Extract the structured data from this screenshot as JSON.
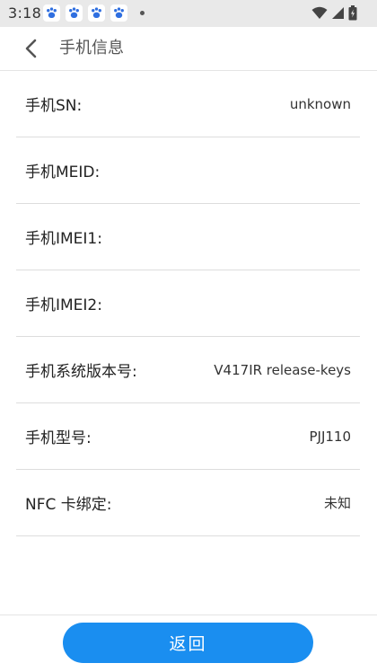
{
  "status_bar": {
    "time": "3:18",
    "notification_icons": [
      "baidu-paw-icon",
      "baidu-paw-icon",
      "baidu-paw-icon",
      "baidu-paw-icon"
    ],
    "indicators": [
      "wifi-icon",
      "signal-icon",
      "battery-icon"
    ]
  },
  "header": {
    "title": "手机信息",
    "back_icon": "chevron-left-icon"
  },
  "info": {
    "rows": [
      {
        "label": "手机SN:",
        "value": "unknown"
      },
      {
        "label": "手机MEID:",
        "value": ""
      },
      {
        "label": "手机IMEI1:",
        "value": ""
      },
      {
        "label": "手机IMEI2:",
        "value": ""
      },
      {
        "label": "手机系统版本号:",
        "value": "V417IR release-keys"
      },
      {
        "label": "手机型号:",
        "value": "PJJ110"
      },
      {
        "label": "NFC 卡绑定:",
        "value": "未知"
      }
    ]
  },
  "footer": {
    "return_label": "返回"
  },
  "colors": {
    "accent": "#1a8ef0",
    "notification_icon": "#2f6fe0",
    "status_bar_bg": "#e9e9e9",
    "divider": "#dddddd"
  }
}
